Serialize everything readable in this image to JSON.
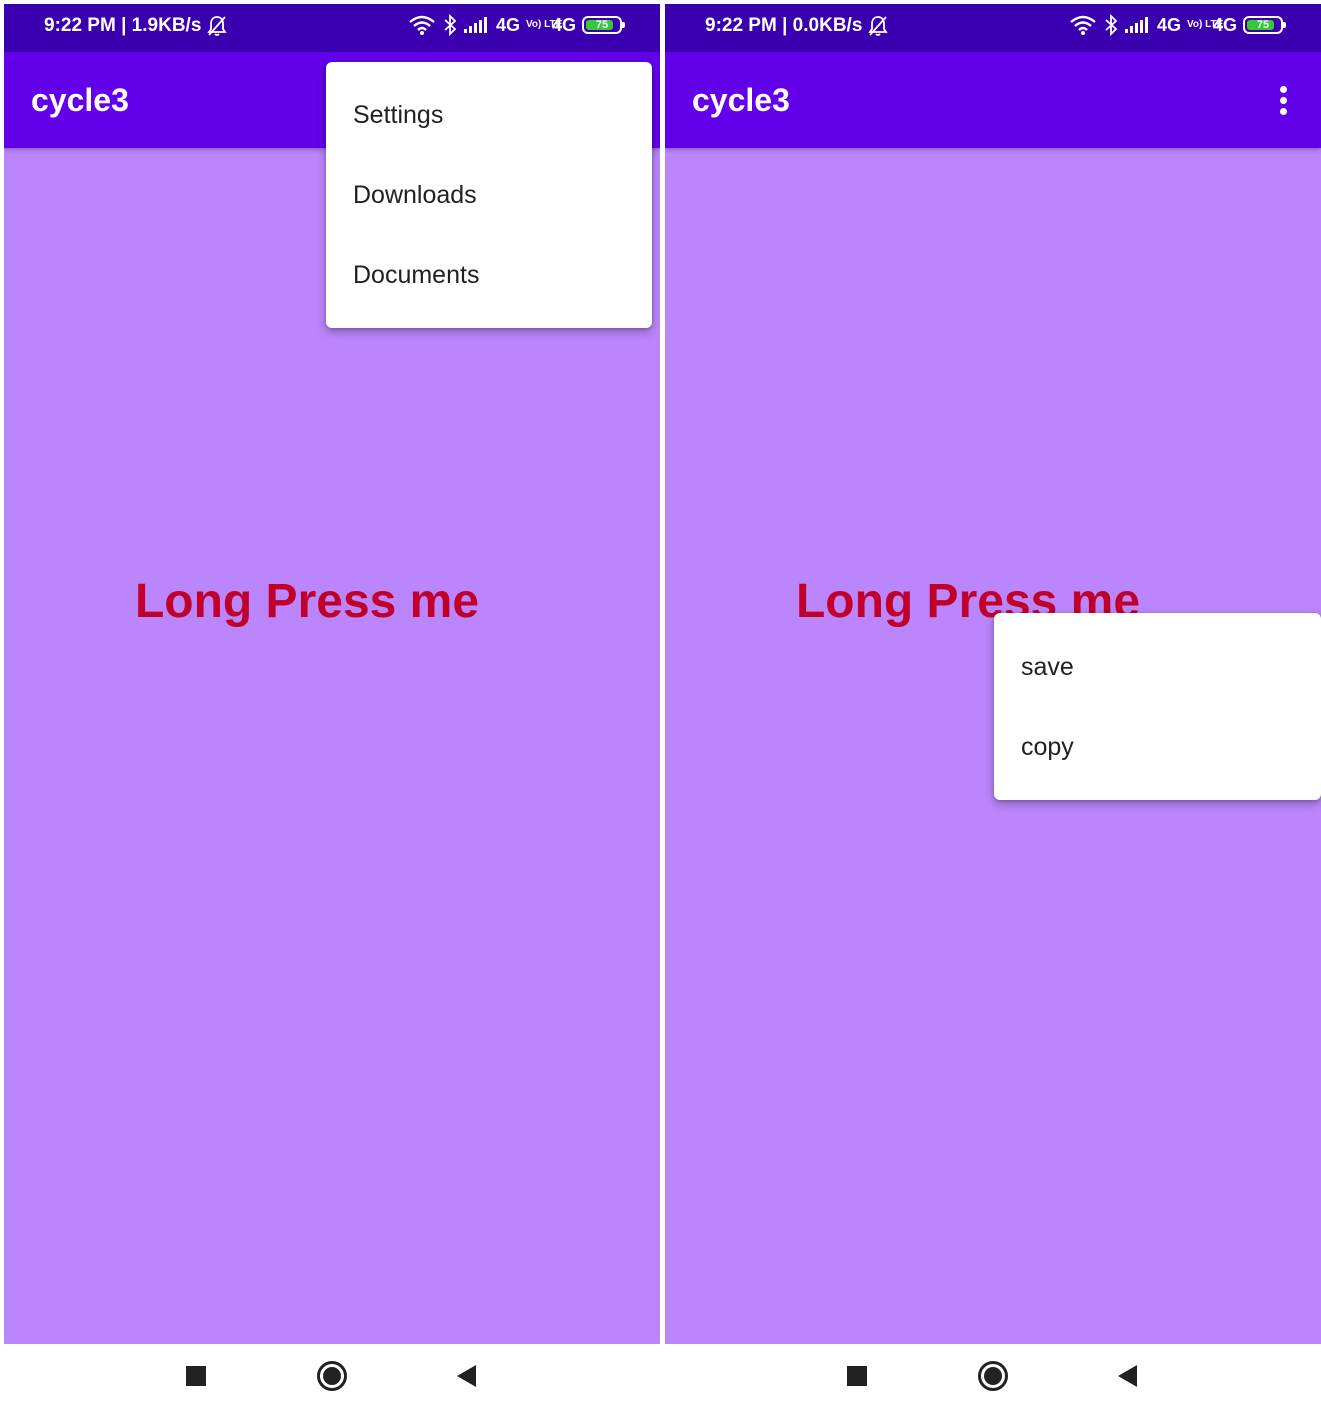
{
  "colors": {
    "status_bar": "#3a00b0",
    "app_bar": "#6200ea",
    "content_bg": "#bb86fc",
    "headline_text": "#c0002a",
    "battery_fill": "#37c837"
  },
  "left_screen": {
    "status": {
      "time_speed": "9:22 PM | 1.9KB/s",
      "mute_icon": "bell-off-icon",
      "network_1": "4G",
      "volte": "Vo) LTE",
      "network_2": "4G",
      "battery": "75"
    },
    "app_title": "cycle3",
    "headline": "Long Press me",
    "options_menu": {
      "items": [
        "Settings",
        "Downloads",
        "Documents"
      ]
    }
  },
  "right_screen": {
    "status": {
      "time_speed": "9:22 PM | 0.0KB/s",
      "mute_icon": "bell-off-icon",
      "network_1": "4G",
      "volte": "Vo) LTE",
      "network_2": "4G",
      "battery": "75"
    },
    "app_title": "cycle3",
    "overflow_icon": "more-vert-icon",
    "headline": "Long Press me",
    "context_menu": {
      "items": [
        "save",
        "copy"
      ]
    }
  },
  "navbar": {
    "recent_icon": "recent-apps-icon",
    "home_icon": "home-icon",
    "back_icon": "back-icon"
  }
}
